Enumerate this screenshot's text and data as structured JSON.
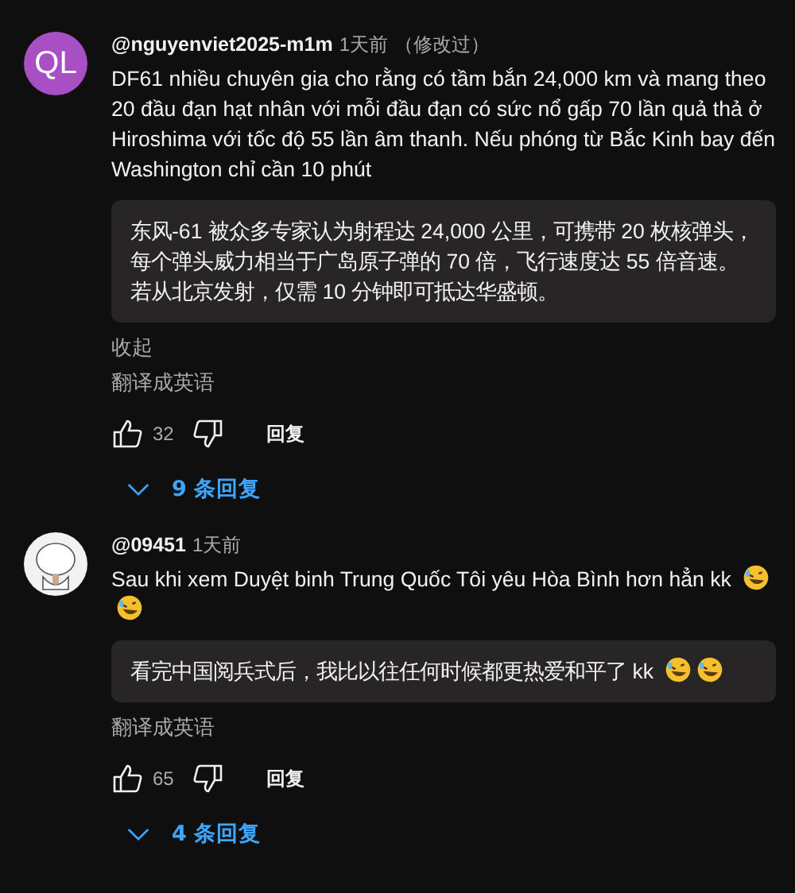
{
  "comments": [
    {
      "avatar": {
        "kind": "initials",
        "text": "QL",
        "color": "#a94fc4"
      },
      "author": "@nguyenviet2025-m1m",
      "time": "1天前",
      "edited": "（修改过）",
      "text": "DF61 nhiều chuyên gia cho rằng có tầm bắn 24,000 km và mang theo 20 đầu đạn hạt nhân với mỗi đầu đạn có sức nổ gấp 70 lần quả thả ở Hiroshima với tốc độ 55 lần âm thanh. Nếu phóng từ Bắc Kinh bay đến Washington chỉ cần 10 phút",
      "translation": "东风-61 被众多专家认为射程达 24,000 公里，可携带 20 枚核弹头，每个弹头威力相当于广岛原子弹的 70 倍，飞行速度达 55 倍音速。若从北京发射，仅需 10 分钟即可抵达华盛顿。",
      "collapse": "收起",
      "translate": "翻译成英语",
      "likes": "32",
      "reply": "回复",
      "replies": "9 条回复"
    },
    {
      "avatar": {
        "kind": "drawing"
      },
      "author": "@09451",
      "time": "1天前",
      "text": "Sau khi xem Duyệt binh Trung Quốc Tôi yêu Hòa Bình hơn hẳn kk",
      "emojis": [
        {
          "kind": "rofl"
        },
        {
          "kind": "rofl"
        }
      ],
      "translation": "看完中国阅兵式后，我比以往任何时候都更热爱和平了 kk",
      "translation_emojis": [
        {
          "kind": "rofl"
        },
        {
          "kind": "rofl"
        }
      ],
      "translate": "翻译成英语",
      "likes": "65",
      "reply": "回复",
      "replies": "4 条回复"
    }
  ]
}
